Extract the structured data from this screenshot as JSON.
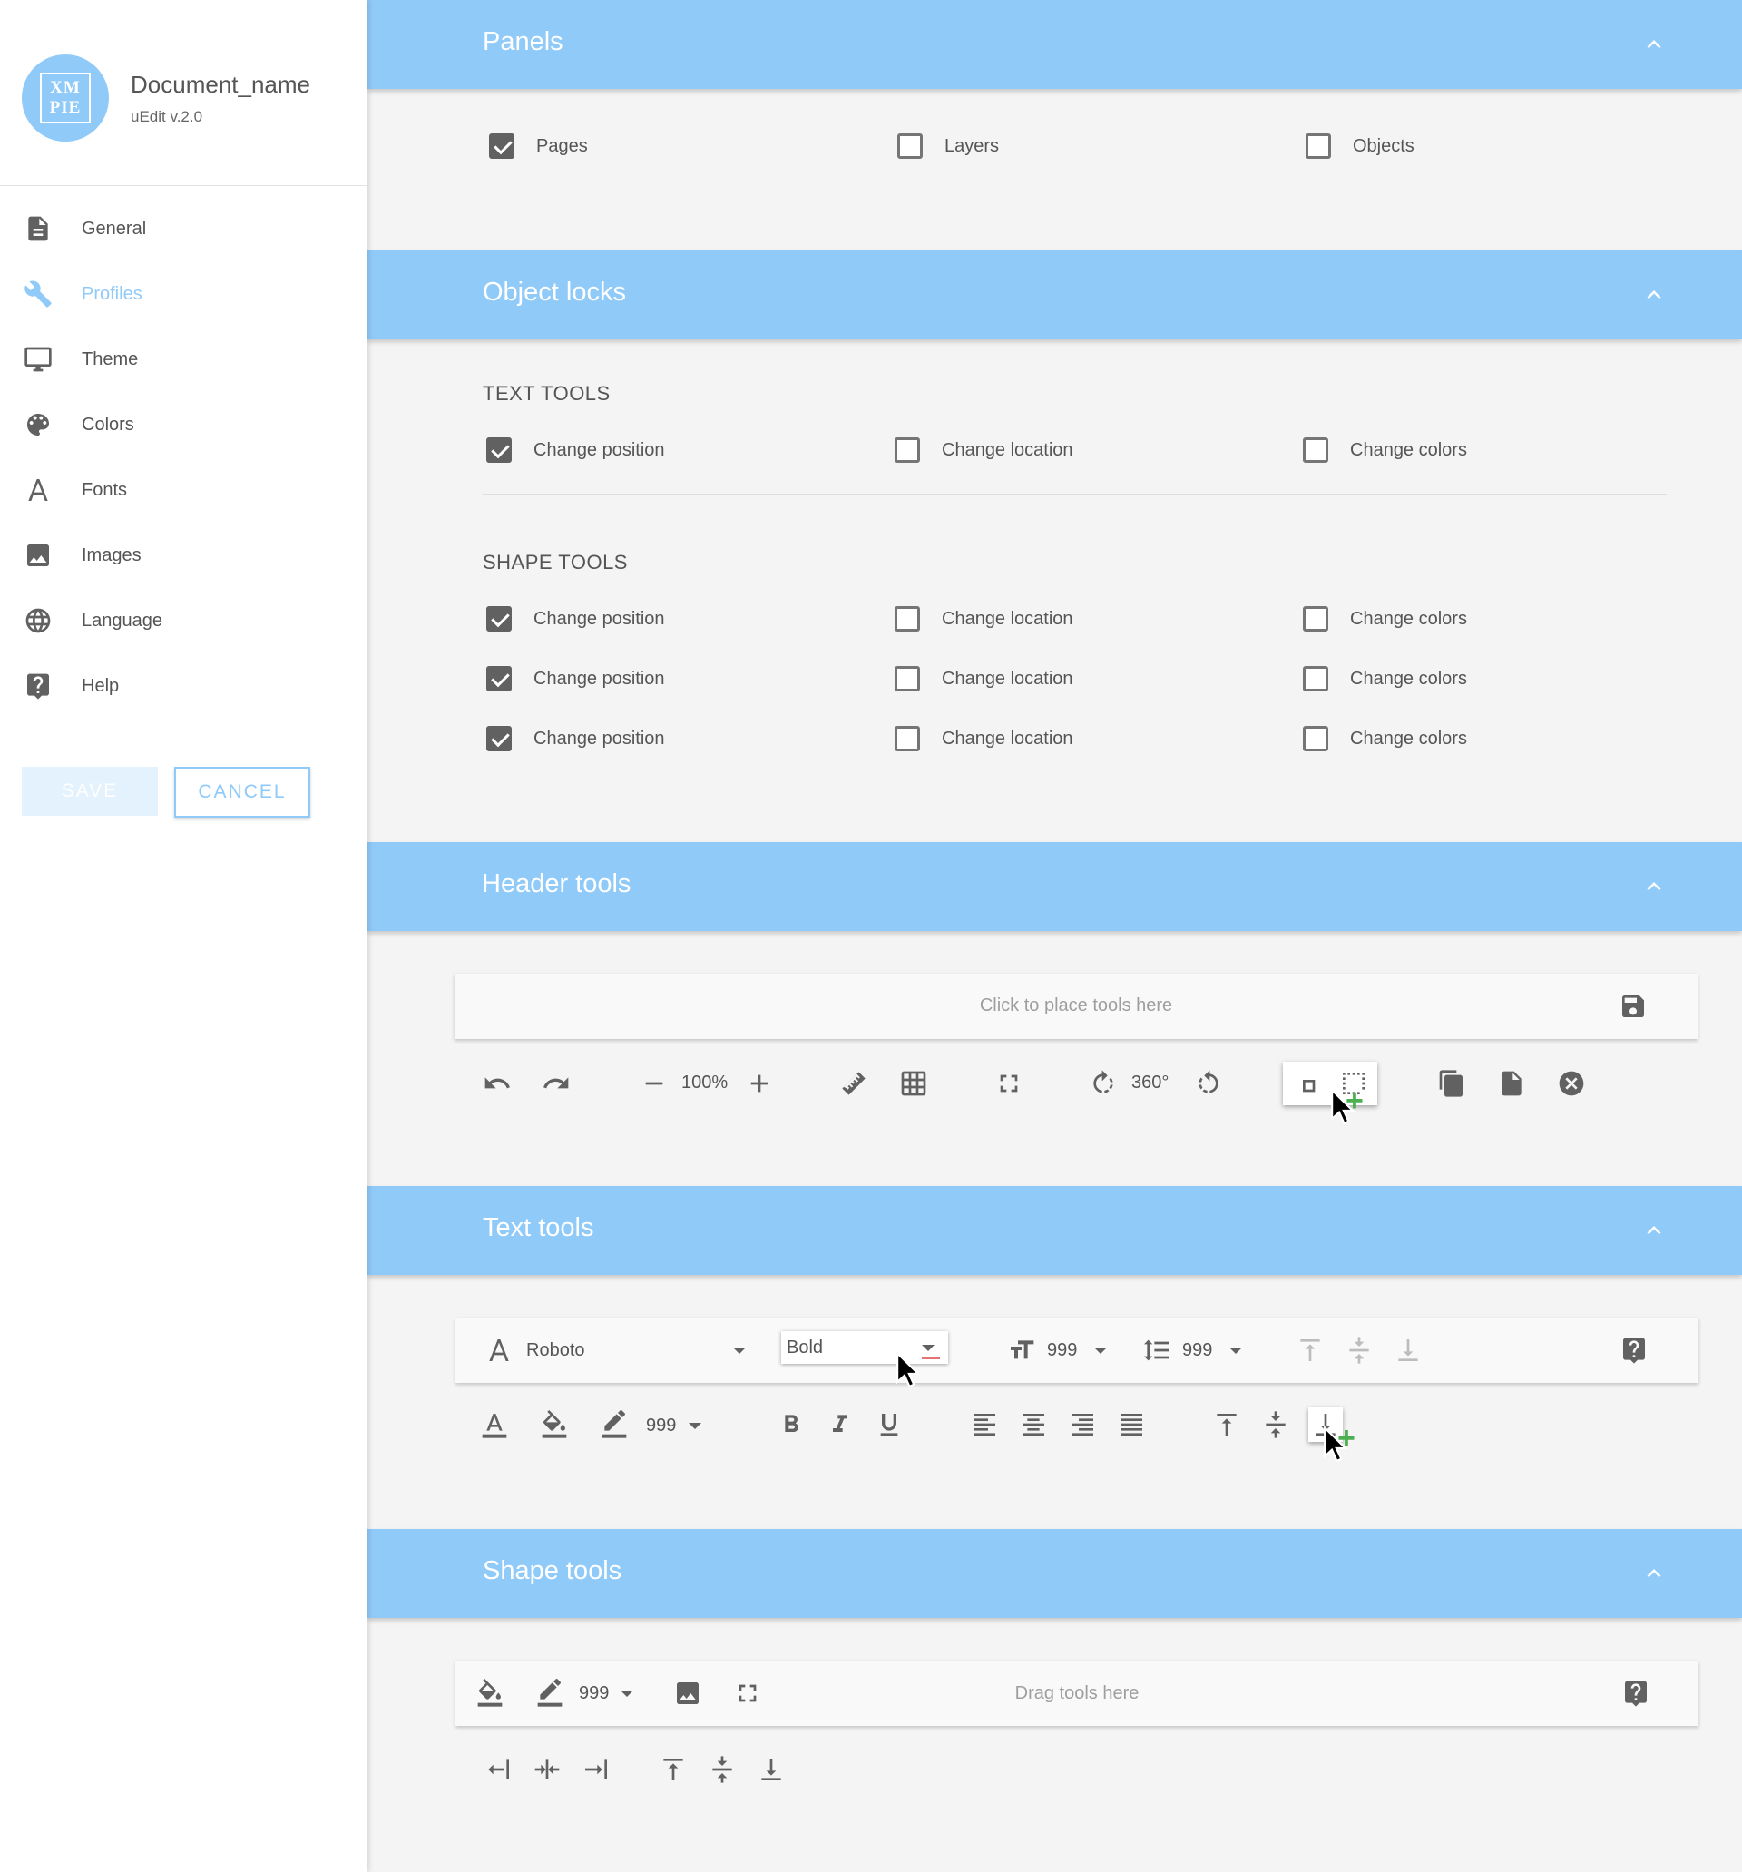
{
  "app": {
    "logo_text_line1": "XM",
    "logo_text_line2": "PIE",
    "document_name": "Document_name",
    "version": "uEdit v.2.0"
  },
  "sidebar": {
    "items": [
      {
        "label": "General",
        "icon": "document-icon",
        "active": false
      },
      {
        "label": "Profiles",
        "icon": "wrench-icon",
        "active": true
      },
      {
        "label": "Theme",
        "icon": "monitor-icon",
        "active": false
      },
      {
        "label": "Colors",
        "icon": "palette-icon",
        "active": false
      },
      {
        "label": "Fonts",
        "icon": "font-icon",
        "active": false
      },
      {
        "label": "Images",
        "icon": "image-icon",
        "active": false
      },
      {
        "label": "Language",
        "icon": "globe-icon",
        "active": false
      },
      {
        "label": "Help",
        "icon": "help-icon",
        "active": false
      }
    ],
    "save_label": "SAVE",
    "cancel_label": "CANCEL"
  },
  "colors": {
    "accent": "#90caf9",
    "save_bg": "#e3f2fd",
    "icon_gray": "#616161",
    "add_green": "#4caf50"
  },
  "panels": {
    "title": "Panels",
    "options": [
      {
        "label": "Pages",
        "checked": true
      },
      {
        "label": "Layers",
        "checked": false
      },
      {
        "label": "Objects",
        "checked": false
      }
    ]
  },
  "object_locks": {
    "title": "Object locks",
    "text_tools_heading": "TEXT TOOLS",
    "text_tools": [
      {
        "label": "Change position",
        "checked": true
      },
      {
        "label": "Change location",
        "checked": false
      },
      {
        "label": "Change colors",
        "checked": false
      }
    ],
    "shape_tools_heading": "SHAPE TOOLS",
    "shape_tools_rows": [
      [
        {
          "label": "Change position",
          "checked": true
        },
        {
          "label": "Change location",
          "checked": false
        },
        {
          "label": "Change colors",
          "checked": false
        }
      ],
      [
        {
          "label": "Change position",
          "checked": true
        },
        {
          "label": "Change location",
          "checked": false
        },
        {
          "label": "Change colors",
          "checked": false
        }
      ],
      [
        {
          "label": "Change position",
          "checked": true
        },
        {
          "label": "Change location",
          "checked": false
        },
        {
          "label": "Change colors",
          "checked": false
        }
      ]
    ]
  },
  "header_tools": {
    "title": "Header tools",
    "placeholder": "Click to place tools here",
    "zoom_value": "100%",
    "rotation_value": "360°"
  },
  "text_tools": {
    "title": "Text tools",
    "font_name": "Roboto",
    "font_weight": "Bold",
    "font_size": "999",
    "line_height": "999",
    "stroke_width": "999"
  },
  "shape_tools": {
    "title": "Shape tools",
    "placeholder": "Drag tools here",
    "stroke_width": "999"
  }
}
